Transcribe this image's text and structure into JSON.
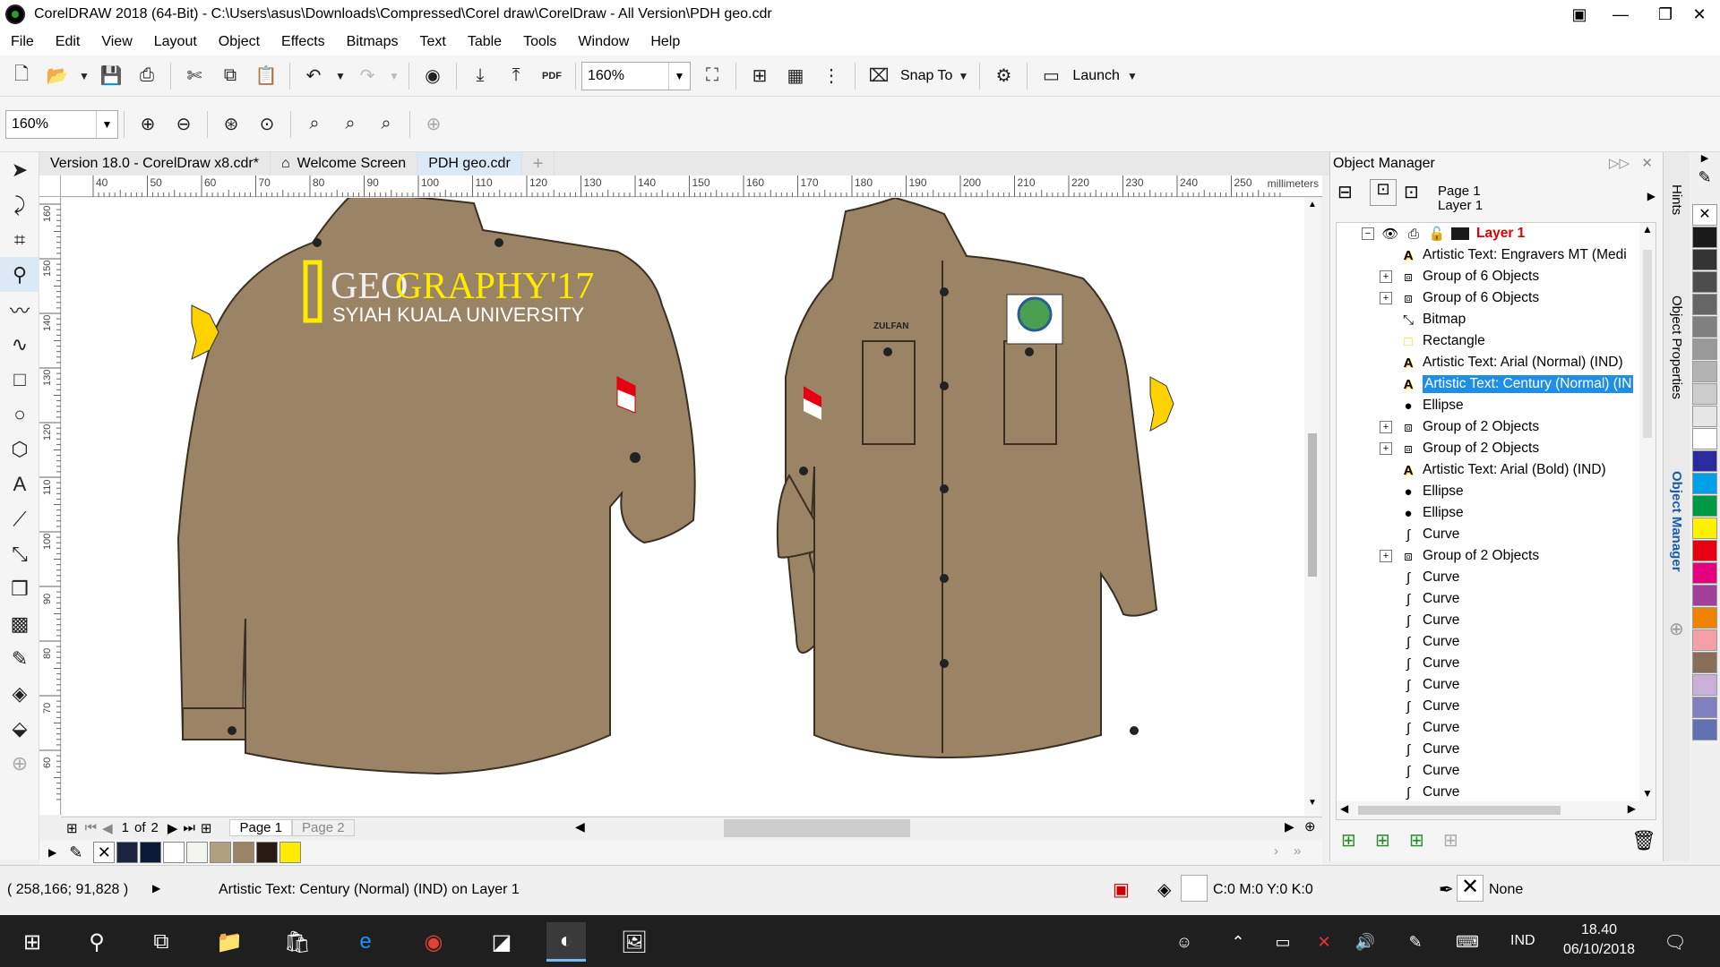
{
  "window": {
    "title": "CorelDRAW 2018 (64-Bit) - C:\\Users\\asus\\Downloads\\Compressed\\Corel draw\\CorelDraw - All Version\\PDH geo.cdr"
  },
  "menu": [
    "File",
    "Edit",
    "View",
    "Layout",
    "Object",
    "Effects",
    "Bitmaps",
    "Text",
    "Table",
    "Tools",
    "Window",
    "Help"
  ],
  "toolbar": {
    "zoom_value": "160%",
    "snap_label": "Snap To",
    "launch_label": "Launch",
    "zoom_value_2": "160%",
    "pdf_label": "PDF"
  },
  "doc_tabs": [
    "Version 18.0 - CorelDraw x8.cdr*",
    "Welcome Screen",
    "PDH geo.cdr"
  ],
  "ruler": {
    "h_ticks": [
      "40",
      "50",
      "60",
      "70",
      "80",
      "90",
      "100",
      "110",
      "120",
      "130",
      "140",
      "150",
      "160",
      "170",
      "180",
      "190",
      "200",
      "210",
      "220",
      "230",
      "240",
      "250"
    ],
    "unit": "millimeters",
    "v_ticks": [
      "160",
      "150",
      "140",
      "130",
      "120",
      "110",
      "100",
      "90",
      "80",
      "70",
      "60"
    ]
  },
  "artwork": {
    "logo_text_1": "GEO",
    "logo_text_2": "GRAPHY'17",
    "logo_text_3": "SYIAH KUALA UNIVERSITY",
    "name_tag": "ZULFAN",
    "shirt_color": "#9b8466"
  },
  "page_nav": {
    "page_of": "1",
    "of_label": "of",
    "total": "2",
    "page1": "Page 1",
    "page2": "Page 2"
  },
  "object_manager": {
    "title": "Object Manager",
    "page": "Page 1",
    "layer": "Layer 1",
    "layer_name": "Layer 1",
    "items": [
      {
        "label": "Artistic Text: Engravers MT (Medi",
        "icon": "text-icon",
        "expand": false
      },
      {
        "label": "Group of 6 Objects",
        "icon": "group-icon",
        "expand": true
      },
      {
        "label": "Group of 6 Objects",
        "icon": "group-icon",
        "expand": true
      },
      {
        "label": "Bitmap",
        "icon": "bitmap-icon",
        "expand": false
      },
      {
        "label": "Rectangle",
        "icon": "rectangle-icon",
        "expand": false
      },
      {
        "label": "Artistic Text: Arial (Normal) (IND)",
        "icon": "text-icon",
        "expand": false
      },
      {
        "label": "Artistic Text: Century (Normal) (IN",
        "icon": "text-icon",
        "expand": false,
        "selected": true
      },
      {
        "label": "Ellipse",
        "icon": "ellipse-icon",
        "expand": false
      },
      {
        "label": "Group of 2 Objects",
        "icon": "group-icon",
        "expand": true
      },
      {
        "label": "Group of 2 Objects",
        "icon": "group-icon",
        "expand": true
      },
      {
        "label": "Artistic Text: Arial (Bold) (IND)",
        "icon": "text-icon",
        "expand": false
      },
      {
        "label": "Ellipse",
        "icon": "ellipse-icon",
        "expand": false
      },
      {
        "label": "Ellipse",
        "icon": "ellipse-icon",
        "expand": false
      },
      {
        "label": "Curve",
        "icon": "curve-icon",
        "expand": false
      },
      {
        "label": "Group of 2 Objects",
        "icon": "group-icon",
        "expand": true
      },
      {
        "label": "Curve",
        "icon": "curve-icon",
        "expand": false
      },
      {
        "label": "Curve",
        "icon": "curve-icon",
        "expand": false
      },
      {
        "label": "Curve",
        "icon": "curve-icon",
        "expand": false
      },
      {
        "label": "Curve",
        "icon": "curve-icon",
        "expand": false
      },
      {
        "label": "Curve",
        "icon": "curve-icon",
        "expand": false
      },
      {
        "label": "Curve",
        "icon": "curve-icon",
        "expand": false
      },
      {
        "label": "Curve",
        "icon": "curve-icon",
        "expand": false
      },
      {
        "label": "Curve",
        "icon": "curve-icon",
        "expand": false
      },
      {
        "label": "Curve",
        "icon": "curve-icon",
        "expand": false
      },
      {
        "label": "Curve",
        "icon": "curve-icon",
        "expand": false
      },
      {
        "label": "Curve",
        "icon": "curve-icon",
        "expand": false
      }
    ]
  },
  "side_tabs": [
    "Hints",
    "Object Properties",
    "Object Manager"
  ],
  "palette_colors": [
    "#ffffff",
    "#1a2340",
    "#0c1a3a",
    "#ffffff",
    "#f5f5f0",
    "#b0a080",
    "#9b8466",
    "#2a1a14",
    "#ffeb00"
  ],
  "right_palette": [
    "#ffffff",
    "#1a1a1a",
    "#333333",
    "#4d4d4d",
    "#666666",
    "#808080",
    "#999999",
    "#b3b3b3",
    "#cccccc",
    "#e6e6e6",
    "#ffffff",
    "#2b2b9e",
    "#00a0e9",
    "#009944",
    "#fff100",
    "#e60012",
    "#e4007f",
    "#a0409a",
    "#f08300",
    "#f3a0a8",
    "#8a6e5c",
    "#c8b0d8",
    "#8080c0",
    "#6070b0"
  ],
  "status": {
    "coords": "( 258,166; 91,828 )",
    "message": "Artistic Text: Century (Normal) (IND) on Layer 1",
    "fill": "C:0 M:0 Y:0 K:0",
    "outline": "None"
  },
  "taskbar": {
    "time": "18.40",
    "date": "06/10/2018",
    "lang": "IND"
  }
}
